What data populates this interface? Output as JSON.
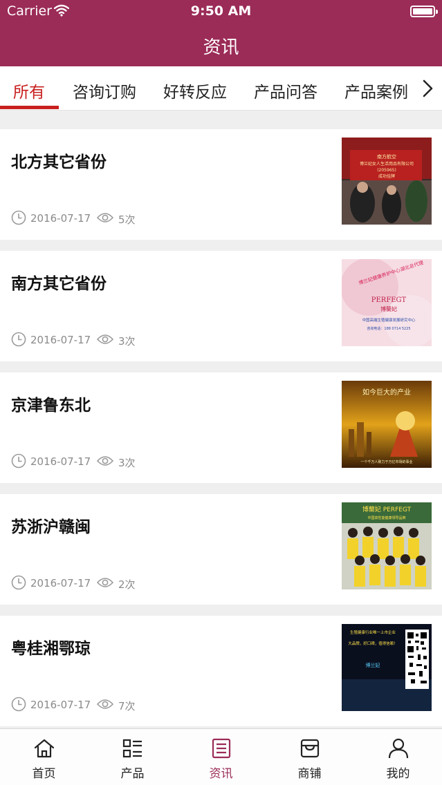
{
  "status_bar": {
    "carrier": "Carrier",
    "time": "9:50 AM"
  },
  "nav": {
    "title": "资讯"
  },
  "tabs": [
    {
      "label": "所有",
      "active": true
    },
    {
      "label": "咨询订购",
      "active": false
    },
    {
      "label": "好转反应",
      "active": false
    },
    {
      "label": "产品问答",
      "active": false
    },
    {
      "label": "产品案例",
      "active": false
    }
  ],
  "articles": [
    {
      "title": "北方其它省份",
      "date": "2016-07-17",
      "views": "5次",
      "thumb": "photo of a meeting room with red banner"
    },
    {
      "title": "南方其它省份",
      "date": "2016-07-17",
      "views": "3次",
      "thumb": "pink poster with PERFEGT logo"
    },
    {
      "title": "京津鲁东北",
      "date": "2016-07-17",
      "views": "3次",
      "thumb": "golden poster with calligraphy"
    },
    {
      "title": "苏浙沪赣闽",
      "date": "2016-07-17",
      "views": "2次",
      "thumb": "group photo in yellow shirts"
    },
    {
      "title": "粤桂湘鄂琼",
      "date": "2016-07-17",
      "views": "7次",
      "thumb": "dark poster with QR code"
    }
  ],
  "bottom_tabs": [
    {
      "label": "首页",
      "icon": "home-icon",
      "active": false
    },
    {
      "label": "产品",
      "icon": "list-icon",
      "active": false
    },
    {
      "label": "资讯",
      "icon": "news-icon",
      "active": true
    },
    {
      "label": "商铺",
      "icon": "shop-icon",
      "active": false
    },
    {
      "label": "我的",
      "icon": "user-icon",
      "active": false
    }
  ],
  "colors": {
    "brand": "#9b2b57",
    "tab_active": "#c8201f",
    "meta": "#8a8a8a"
  },
  "thumb_text": {
    "item1": [
      "南方航空",
      "博兰妃女人生活用品有限公司",
      "(205965)",
      "成功挂牌"
    ],
    "item2": [
      "博兰妃健康养护中心湖北总代理",
      "PERFEGT",
      "博蘭妃",
      "中国高端生殖健康发展研究中心",
      "咨询电话：188 0714 5225"
    ],
    "item3": [
      "如今巨大的产业",
      "一个千万人致力于万亿市场的事业"
    ],
    "item4": [
      "博蘭妃 PERFEGT",
      "中国高性能健康领导品牌"
    ],
    "item5": [
      "生殖健康行业唯一上市企业",
      "大品牌，好口碑，值得信赖！",
      "博兰妃"
    ]
  }
}
